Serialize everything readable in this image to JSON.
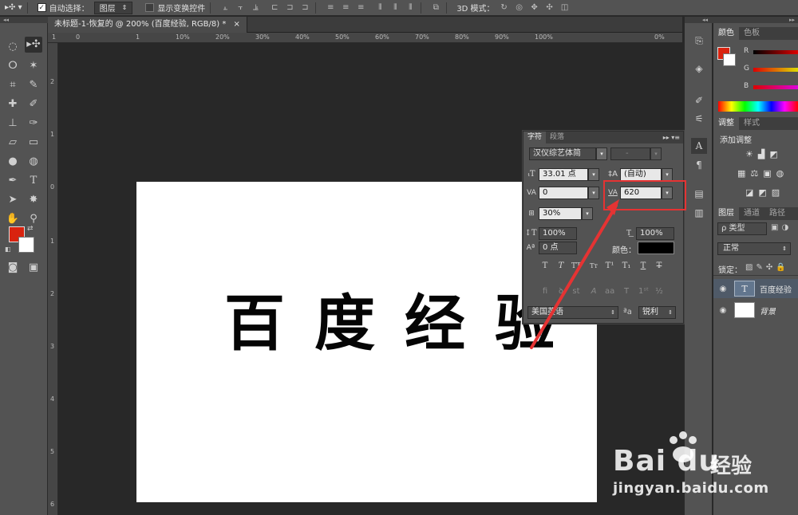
{
  "options_bar": {
    "auto_select_label": "自动选择：",
    "auto_select_value": "图层",
    "show_transform_label": "显示变换控件",
    "mode_3d_label": "3D 模式："
  },
  "document": {
    "tab_title": "未标题-1-恢复的 @ 200% (百度经验, RGB/8) *",
    "close": "×",
    "canvas_text": "百度经验",
    "h_ruler": [
      "1",
      "0",
      "1",
      "10%",
      "20%",
      "30%",
      "40%",
      "50%",
      "60%",
      "70%",
      "80%",
      "90%",
      "100%",
      "0%"
    ],
    "v_ruler": [
      "2",
      "1",
      "0",
      "1",
      "2",
      "3",
      "4",
      "5",
      "6"
    ]
  },
  "character_panel": {
    "tab_character": "字符",
    "tab_paragraph": "段落",
    "font_family": "汉仪综艺体简",
    "font_style": "-",
    "font_size": "33.01 点",
    "leading": "(自动)",
    "kerning": "0",
    "tracking": "620",
    "tsume": "30%",
    "vertical_scale": "100%",
    "horizontal_scale": "100%",
    "baseline_shift": "0 点",
    "color_label": "颜色：",
    "language": "美国英语",
    "aa_label": "ªa",
    "antialias": "锐利",
    "text_color": "#000000"
  },
  "color_panel": {
    "tab_color": "颜色",
    "tab_swatches": "色板",
    "r_label": "R",
    "g_label": "G",
    "b_label": "B",
    "foreground": "#d9230f"
  },
  "adjust_panel": {
    "tab_adjust": "调整",
    "tab_styles": "样式",
    "add_label": "添加调整"
  },
  "layers_panel": {
    "tab_layers": "图层",
    "tab_channels": "通道",
    "tab_paths": "路径",
    "filter_label": "ρ 类型",
    "blend_mode": "正常",
    "lock_label": "锁定：",
    "layers": [
      {
        "name": "百度经验",
        "kind": "T"
      },
      {
        "name": "背景",
        "kind": ""
      }
    ]
  },
  "toolbar": {
    "foreground": "#d9230f",
    "background": "#ffffff"
  },
  "watermark": {
    "logo": "Bai",
    "logo_end": "du",
    "product": "经验",
    "url": "jingyan.baidu.com"
  }
}
